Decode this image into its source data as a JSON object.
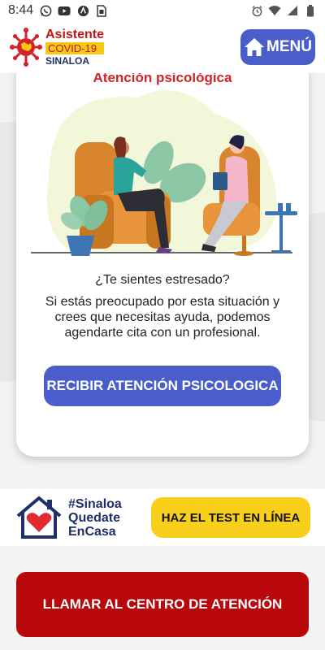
{
  "status_bar": {
    "time": "8:44",
    "icons": [
      "whatsapp-icon",
      "youtube-icon",
      "maps-icon",
      "sim-icon",
      "alarm-icon",
      "wifi-icon",
      "signal-icon",
      "battery-icon"
    ]
  },
  "header": {
    "logo": {
      "line1": "Asistente",
      "line2": "COVID-19",
      "line3": "SINALOA"
    },
    "menu_label": "MENÚ"
  },
  "card": {
    "title": "Atención psicológica",
    "question": "¿Te sientes estresado?",
    "description": "Si estás preocupado por esta situación y crees que necesitas ayuda, podemos agendarte cita con un profesional.",
    "cta_label": "RECIBIR ATENCIÓN PSICOLOGICA"
  },
  "campaign": {
    "line1": "#Sinaloa",
    "line2": "Quedate",
    "line3": "EnCasa"
  },
  "test_button_label": "HAZ EL TEST EN LÍNEA",
  "call_button_label": "LLAMAR AL CENTRO DE ATENCIÓN",
  "colors": {
    "primary": "#4a5ecb",
    "accent_red": "#b8080b",
    "title_red": "#d2232a",
    "yellow": "#f8cf1a",
    "navy": "#1f2f6b"
  }
}
